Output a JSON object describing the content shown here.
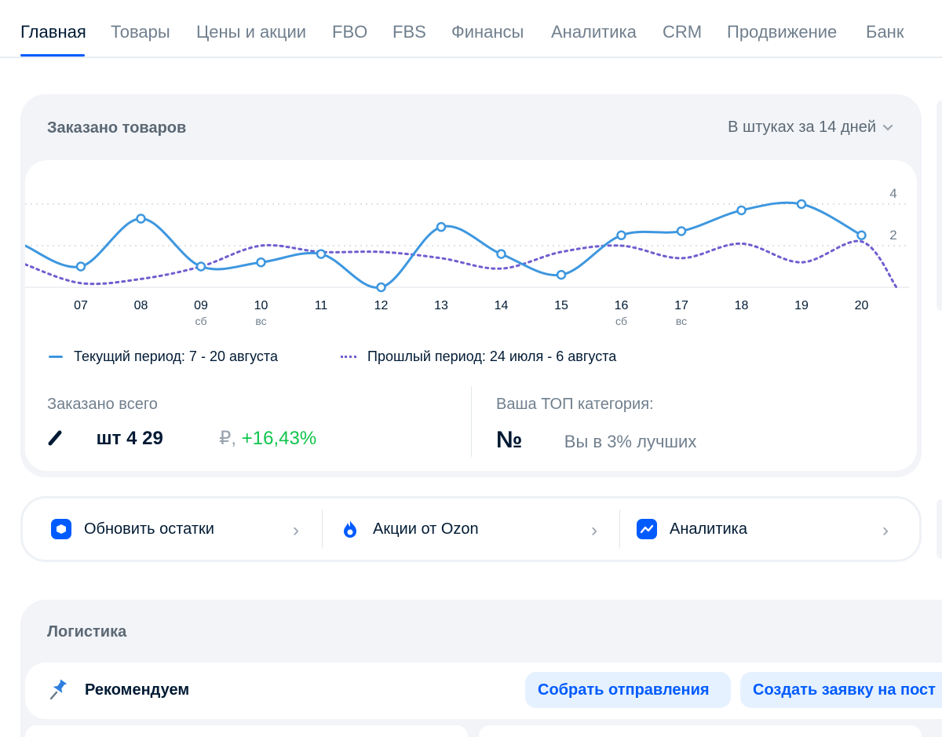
{
  "nav": {
    "tabs": [
      "Главная",
      "Товары",
      "Цены и акции",
      "FBO",
      "FBS",
      "Финансы",
      "Аналитика",
      "CRM",
      "Продвижение",
      "Банк"
    ]
  },
  "orders": {
    "title": "Заказано товаров",
    "period_select": "В штуках за 14 дней",
    "legend_current": "Текущий период: 7 - 20 августа",
    "legend_previous": "Прошлый период: 24 июля - 6 августа",
    "total_label": "Заказано всего",
    "total_value": "шт 4 29",
    "total_currency": "₽,",
    "total_change": "+16,43%",
    "top_label": "Ваша ТОП категория:",
    "top_number_sign": "№",
    "top_text": "Вы в 3% лучших"
  },
  "chart_data": {
    "type": "line",
    "x": [
      "07",
      "08",
      "09",
      "10",
      "11",
      "12",
      "13",
      "14",
      "15",
      "16",
      "17",
      "18",
      "19",
      "20"
    ],
    "x_sublabels": [
      "",
      "",
      "сб",
      "вс",
      "",
      "",
      "",
      "",
      "",
      "сб",
      "вс",
      "",
      "",
      ""
    ],
    "y_ticks": [
      2,
      4
    ],
    "ylim": [
      0,
      4.5
    ],
    "grid": "dotted horizontal at 2 and 4",
    "series": [
      {
        "name": "Текущий период: 7 - 20 августа",
        "style": "solid",
        "color": "#3e97df",
        "values": [
          1,
          3.3,
          1,
          1.2,
          1.6,
          0,
          2.9,
          1.6,
          0.6,
          2.5,
          2.7,
          3.7,
          4,
          2.5
        ]
      },
      {
        "name": "Прошлый период: 24 июля - 6 августа",
        "style": "dotted",
        "color": "#6f5fd0",
        "values": [
          0.2,
          0.4,
          1,
          2,
          1.7,
          1.7,
          1.4,
          0.9,
          1.7,
          2,
          1.4,
          2.1,
          1.2,
          2.2
        ]
      }
    ]
  },
  "actions": [
    {
      "label": "Обновить остатки",
      "icon": "box-icon"
    },
    {
      "label": "Акции от Ozon",
      "icon": "fire-icon"
    },
    {
      "label": "Аналитика",
      "icon": "trend-icon"
    }
  ],
  "logistics": {
    "title": "Логистика",
    "recommend_label": "Рекомендуем",
    "btn_collect": "Собрать отправления",
    "btn_create": "Создать заявку на пост"
  },
  "colors": {
    "accent": "#005bff",
    "positive": "#10c44c",
    "current_line": "#3e97df",
    "previous_line": "#6f5fd0"
  }
}
